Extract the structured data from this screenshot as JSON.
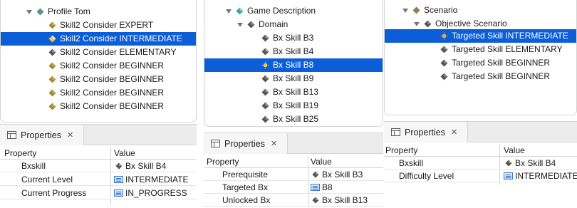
{
  "panels": [
    {
      "tree": {
        "root": {
          "label": "Profile Tom"
        },
        "items": [
          {
            "label": "Skill2 Consider EXPERT",
            "selected": false
          },
          {
            "label": "Skill2 Consider INTERMEDIATE",
            "selected": true
          },
          {
            "label": "Skill2 Consider ELEMENTARY",
            "selected": false
          },
          {
            "label": "Skill2 Consider BEGINNER",
            "selected": false
          },
          {
            "label": "Skill2 Consider BEGINNER",
            "selected": false
          },
          {
            "label": "Skill2 Consider BEGINNER",
            "selected": false
          },
          {
            "label": "Skill2 Consider BEGINNER",
            "selected": false
          }
        ]
      },
      "properties": {
        "tab_title": "Properties",
        "close_glyph": "✕",
        "columns": {
          "property": "Property",
          "value": "Value"
        },
        "rows": [
          {
            "property": "Bxskill",
            "value": "Bx Skill B4",
            "value_icon": "diamond-node-icon"
          },
          {
            "property": "Current Level",
            "value": "INTERMEDIATE",
            "value_icon": "enum-icon"
          },
          {
            "property": "Current Progress",
            "value": "IN_PROGRESS",
            "value_icon": "enum-icon"
          }
        ]
      }
    },
    {
      "tree": {
        "root": {
          "label": "Game Description"
        },
        "child": {
          "label": "Domain"
        },
        "items": [
          {
            "label": "Bx Skill B3",
            "selected": false
          },
          {
            "label": "Bx Skill B4",
            "selected": false
          },
          {
            "label": "Bx Skill B8",
            "selected": true
          },
          {
            "label": "Bx Skill B9",
            "selected": false
          },
          {
            "label": "Bx Skill B13",
            "selected": false
          },
          {
            "label": "Bx Skill B19",
            "selected": false
          },
          {
            "label": "Bx Skill B25",
            "selected": false
          }
        ]
      },
      "properties": {
        "tab_title": "Properties",
        "close_glyph": "✕",
        "columns": {
          "property": "Property",
          "value": "Value"
        },
        "rows": [
          {
            "property": "Prerequisite",
            "value": "Bx Skill B3",
            "value_icon": "diamond-node-icon"
          },
          {
            "property": "Targeted Bx",
            "value": "B8",
            "value_icon": "enum-icon"
          },
          {
            "property": "Unlocked Bx",
            "value": "Bx Skill B13",
            "value_icon": "diamond-node-icon"
          }
        ]
      }
    },
    {
      "tree": {
        "root": {
          "label": "Scenario"
        },
        "child": {
          "label": "Objective Scenario"
        },
        "items": [
          {
            "label": "Targeted Skill INTERMEDIATE",
            "selected": true
          },
          {
            "label": "Targeted Skill ELEMENTARY",
            "selected": false
          },
          {
            "label": "Targeted Skill BEGINNER",
            "selected": false
          },
          {
            "label": "Targeted Skill BEGINNER",
            "selected": false
          }
        ]
      },
      "properties": {
        "tab_title": "Properties",
        "close_glyph": "✕",
        "columns": {
          "property": "Property",
          "value": "Value"
        },
        "rows": [
          {
            "property": "Bxskill",
            "value": "Bx Skill B4",
            "value_icon": "diamond-node-icon"
          },
          {
            "property": "Difficulty Level",
            "value": "INTERMEDIATE",
            "value_icon": "enum-icon"
          }
        ]
      }
    }
  ],
  "colors": {
    "selection": "#0b5ed7",
    "root_icon_teal": "#3a9fb0",
    "node_icon_gold": "#c9a227",
    "node_icon_grey": "#6e6e6e"
  }
}
